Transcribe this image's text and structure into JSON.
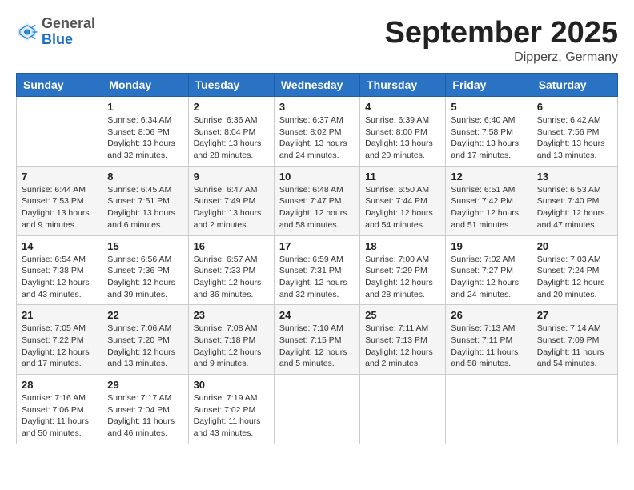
{
  "header": {
    "logo_general": "General",
    "logo_blue": "Blue",
    "month_title": "September 2025",
    "location": "Dipperz, Germany"
  },
  "days_of_week": [
    "Sunday",
    "Monday",
    "Tuesday",
    "Wednesday",
    "Thursday",
    "Friday",
    "Saturday"
  ],
  "weeks": [
    [
      {
        "day": "",
        "info": ""
      },
      {
        "day": "1",
        "info": "Sunrise: 6:34 AM\nSunset: 8:06 PM\nDaylight: 13 hours\nand 32 minutes."
      },
      {
        "day": "2",
        "info": "Sunrise: 6:36 AM\nSunset: 8:04 PM\nDaylight: 13 hours\nand 28 minutes."
      },
      {
        "day": "3",
        "info": "Sunrise: 6:37 AM\nSunset: 8:02 PM\nDaylight: 13 hours\nand 24 minutes."
      },
      {
        "day": "4",
        "info": "Sunrise: 6:39 AM\nSunset: 8:00 PM\nDaylight: 13 hours\nand 20 minutes."
      },
      {
        "day": "5",
        "info": "Sunrise: 6:40 AM\nSunset: 7:58 PM\nDaylight: 13 hours\nand 17 minutes."
      },
      {
        "day": "6",
        "info": "Sunrise: 6:42 AM\nSunset: 7:56 PM\nDaylight: 13 hours\nand 13 minutes."
      }
    ],
    [
      {
        "day": "7",
        "info": "Sunrise: 6:44 AM\nSunset: 7:53 PM\nDaylight: 13 hours\nand 9 minutes."
      },
      {
        "day": "8",
        "info": "Sunrise: 6:45 AM\nSunset: 7:51 PM\nDaylight: 13 hours\nand 6 minutes."
      },
      {
        "day": "9",
        "info": "Sunrise: 6:47 AM\nSunset: 7:49 PM\nDaylight: 13 hours\nand 2 minutes."
      },
      {
        "day": "10",
        "info": "Sunrise: 6:48 AM\nSunset: 7:47 PM\nDaylight: 12 hours\nand 58 minutes."
      },
      {
        "day": "11",
        "info": "Sunrise: 6:50 AM\nSunset: 7:44 PM\nDaylight: 12 hours\nand 54 minutes."
      },
      {
        "day": "12",
        "info": "Sunrise: 6:51 AM\nSunset: 7:42 PM\nDaylight: 12 hours\nand 51 minutes."
      },
      {
        "day": "13",
        "info": "Sunrise: 6:53 AM\nSunset: 7:40 PM\nDaylight: 12 hours\nand 47 minutes."
      }
    ],
    [
      {
        "day": "14",
        "info": "Sunrise: 6:54 AM\nSunset: 7:38 PM\nDaylight: 12 hours\nand 43 minutes."
      },
      {
        "day": "15",
        "info": "Sunrise: 6:56 AM\nSunset: 7:36 PM\nDaylight: 12 hours\nand 39 minutes."
      },
      {
        "day": "16",
        "info": "Sunrise: 6:57 AM\nSunset: 7:33 PM\nDaylight: 12 hours\nand 36 minutes."
      },
      {
        "day": "17",
        "info": "Sunrise: 6:59 AM\nSunset: 7:31 PM\nDaylight: 12 hours\nand 32 minutes."
      },
      {
        "day": "18",
        "info": "Sunrise: 7:00 AM\nSunset: 7:29 PM\nDaylight: 12 hours\nand 28 minutes."
      },
      {
        "day": "19",
        "info": "Sunrise: 7:02 AM\nSunset: 7:27 PM\nDaylight: 12 hours\nand 24 minutes."
      },
      {
        "day": "20",
        "info": "Sunrise: 7:03 AM\nSunset: 7:24 PM\nDaylight: 12 hours\nand 20 minutes."
      }
    ],
    [
      {
        "day": "21",
        "info": "Sunrise: 7:05 AM\nSunset: 7:22 PM\nDaylight: 12 hours\nand 17 minutes."
      },
      {
        "day": "22",
        "info": "Sunrise: 7:06 AM\nSunset: 7:20 PM\nDaylight: 12 hours\nand 13 minutes."
      },
      {
        "day": "23",
        "info": "Sunrise: 7:08 AM\nSunset: 7:18 PM\nDaylight: 12 hours\nand 9 minutes."
      },
      {
        "day": "24",
        "info": "Sunrise: 7:10 AM\nSunset: 7:15 PM\nDaylight: 12 hours\nand 5 minutes."
      },
      {
        "day": "25",
        "info": "Sunrise: 7:11 AM\nSunset: 7:13 PM\nDaylight: 12 hours\nand 2 minutes."
      },
      {
        "day": "26",
        "info": "Sunrise: 7:13 AM\nSunset: 7:11 PM\nDaylight: 11 hours\nand 58 minutes."
      },
      {
        "day": "27",
        "info": "Sunrise: 7:14 AM\nSunset: 7:09 PM\nDaylight: 11 hours\nand 54 minutes."
      }
    ],
    [
      {
        "day": "28",
        "info": "Sunrise: 7:16 AM\nSunset: 7:06 PM\nDaylight: 11 hours\nand 50 minutes."
      },
      {
        "day": "29",
        "info": "Sunrise: 7:17 AM\nSunset: 7:04 PM\nDaylight: 11 hours\nand 46 minutes."
      },
      {
        "day": "30",
        "info": "Sunrise: 7:19 AM\nSunset: 7:02 PM\nDaylight: 11 hours\nand 43 minutes."
      },
      {
        "day": "",
        "info": ""
      },
      {
        "day": "",
        "info": ""
      },
      {
        "day": "",
        "info": ""
      },
      {
        "day": "",
        "info": ""
      }
    ]
  ]
}
